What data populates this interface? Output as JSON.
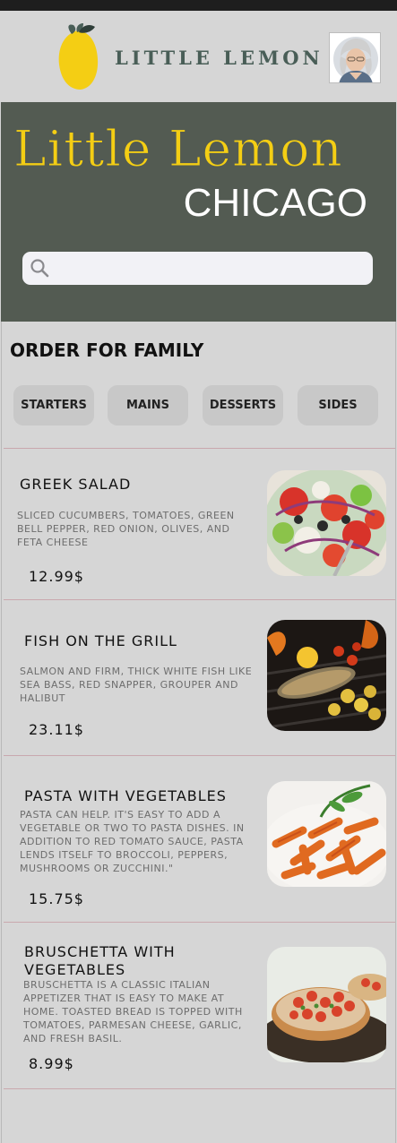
{
  "header": {
    "brand": "LITTLE LEMON"
  },
  "hero": {
    "title": "Little Lemon",
    "subtitle": "CHICAGO",
    "search_placeholder": ""
  },
  "order": {
    "title": "ORDER FOR FAMILY",
    "categories": [
      "STARTERS",
      "MAINS",
      "DESSERTS",
      "SIDES"
    ]
  },
  "menu": [
    {
      "name": "GREEK SALAD",
      "description": "SLICED CUCUMBERS, TOMATOES, GREEN BELL PEPPER, RED ONION, OLIVES, AND FETA CHEESE",
      "price": "12.99$"
    },
    {
      "name": "FISH ON THE GRILL",
      "description": "SALMON AND FIRM, THICK WHITE FISH LIKE SEA BASS, RED SNAPPER, GROUPER AND HALIBUT",
      "price": "23.11$"
    },
    {
      "name": "PASTA WITH VEGETABLES",
      "description": "PASTA CAN HELP. IT'S EASY TO ADD A VEGETABLE OR TWO TO PASTA DISHES. IN ADDITION TO RED TOMATO SAUCE, PASTA LENDS ITSELF TO BROCCOLI, PEPPERS, MUSHROOMS OR ZUCCHINI.\"",
      "price": "15.75$"
    },
    {
      "name": "BRUSCHETTA WITH VEGETABLES",
      "description": "BRUSCHETTA IS A CLASSIC ITALIAN APPETIZER THAT IS EASY TO MAKE AT HOME. TOASTED BREAD IS TOPPED WITH TOMATOES, PARMESAN CHEESE, GARLIC, AND FRESH BASIL.",
      "price": "8.99$"
    }
  ],
  "colors": {
    "brand_green": "#495e57",
    "hero_bg": "#535b52",
    "brand_yellow": "#f4ce14",
    "page_bg": "#d6d6d6"
  }
}
